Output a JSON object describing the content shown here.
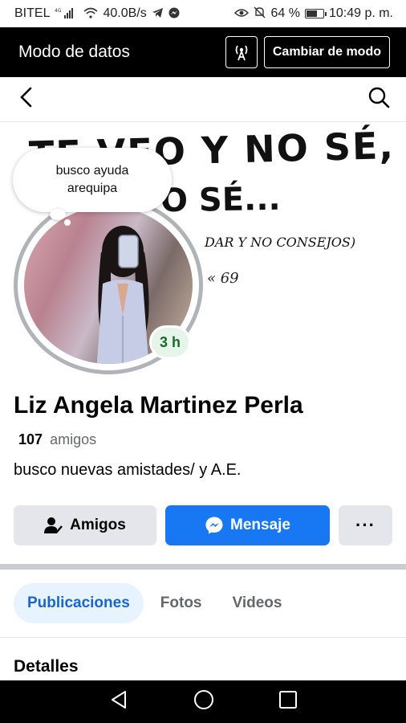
{
  "status_bar": {
    "carrier": "BITEL",
    "network": "4G",
    "speed": "40.0B/s",
    "battery": "64 %",
    "time": "10:49 p. m.",
    "battery_level": 0.64
  },
  "data_mode": {
    "title": "Modo de datos",
    "change_button": "Cambiar de modo"
  },
  "cover": {
    "line1": "TE VEO Y NO SÉ,",
    "line2": "O SÉ...",
    "line3": "DAR Y NO CONSEJOS)",
    "line4": "« 69"
  },
  "note_bubble": {
    "line1": "busco ayuda",
    "line2": "arequipa⁣"
  },
  "story_badge": "3 h",
  "profile": {
    "name": "Liz Angela Martinez Perla",
    "friends_count": "107",
    "friends_label": "amigos",
    "bio": "busco nuevas amistades/ y A.E."
  },
  "actions": {
    "friends": "Amigos",
    "message": "Mensaje",
    "more": "···"
  },
  "tabs": [
    {
      "label": "Publicaciones",
      "active": true
    },
    {
      "label": "Fotos",
      "active": false
    },
    {
      "label": "Videos",
      "active": false
    }
  ],
  "section_title": "Detalles",
  "colors": {
    "primary_blue": "#1877f2",
    "tab_active_bg": "#e7f3ff",
    "badge_green": "#1a6b2a"
  }
}
